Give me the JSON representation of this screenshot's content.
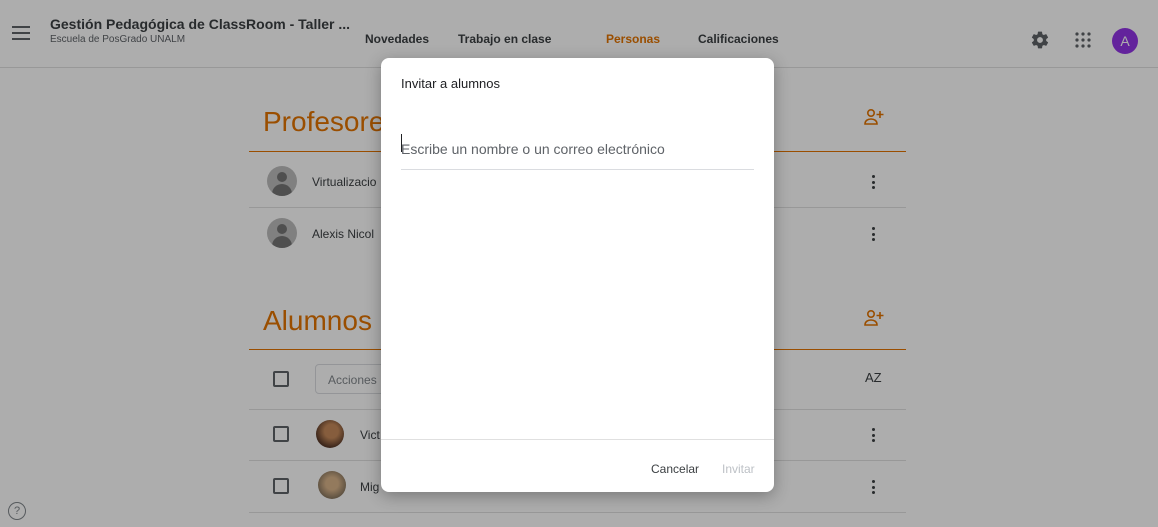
{
  "header": {
    "course_title": "Gestión Pedagógica de ClassRoom - Taller ...",
    "course_subtitle": "Escuela de PosGrado UNALM",
    "tabs": [
      {
        "label": "Novedades"
      },
      {
        "label": "Trabajo en clase"
      },
      {
        "label": "Personas",
        "active": true
      },
      {
        "label": "Calificaciones"
      }
    ],
    "avatar_letter": "A"
  },
  "teachers": {
    "title": "Profesores",
    "items": [
      {
        "name": "Virtualizacio"
      },
      {
        "name": "Alexis Nicol"
      }
    ]
  },
  "students": {
    "title": "Alumnos",
    "actions_label": "Acciones",
    "sort_label": "AZ",
    "items": [
      {
        "name": "Vict"
      },
      {
        "name": "Mig"
      }
    ]
  },
  "dialog": {
    "title": "Invitar a alumnos",
    "input_placeholder": "Escribe un nombre o un correo electrónico",
    "input_value": "",
    "cancel_label": "Cancelar",
    "invite_label": "Invitar"
  },
  "help_label": "?",
  "colors": {
    "accent": "#e37400",
    "avatar": "#9334e6",
    "scrim": "rgba(0,0,0,0.32)"
  },
  "icons": [
    "menu-icon",
    "gear-icon",
    "apps-icon",
    "add-person-icon",
    "kebab-icon",
    "sort-az-icon",
    "help-icon"
  ]
}
